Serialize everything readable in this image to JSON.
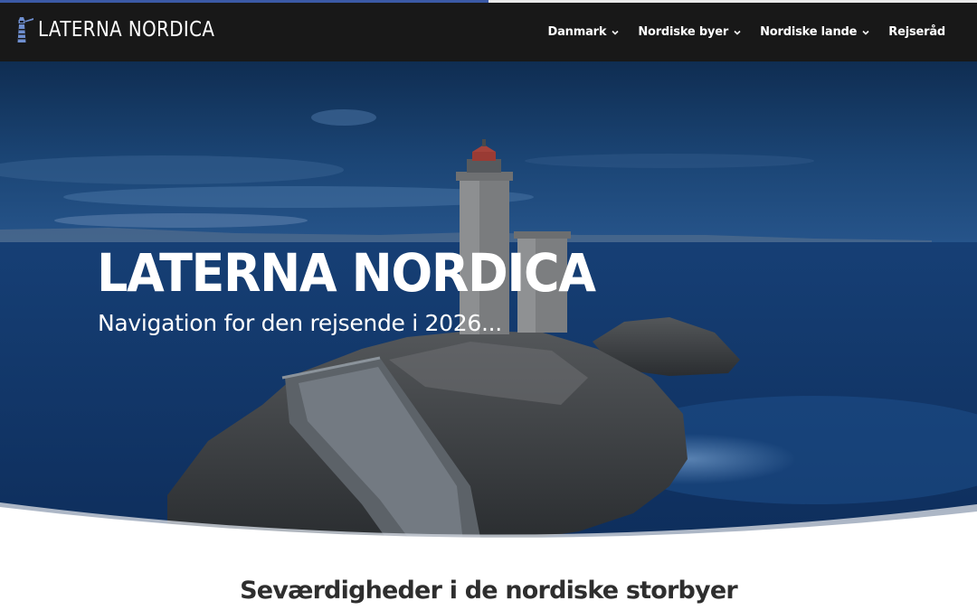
{
  "reading_progress": 0.5,
  "colors": {
    "accent": "#3b5aa6",
    "navbar_bg": "#181818",
    "heading_text": "#2e2e2e"
  },
  "header": {
    "logo_text": "LATERNA NORDICA",
    "logo_icon": "lighthouse-icon",
    "nav": [
      {
        "label": "Danmark",
        "has_dropdown": true
      },
      {
        "label": "Nordiske byer",
        "has_dropdown": true
      },
      {
        "label": "Nordiske lande",
        "has_dropdown": true
      },
      {
        "label": "Rejseråd",
        "has_dropdown": false
      }
    ]
  },
  "hero": {
    "title": "LATERNA NORDICA",
    "subtitle": "Navigation for den rejsende i 2026..."
  },
  "section": {
    "heading": "Seværdigheder i de nordiske storbyer"
  }
}
